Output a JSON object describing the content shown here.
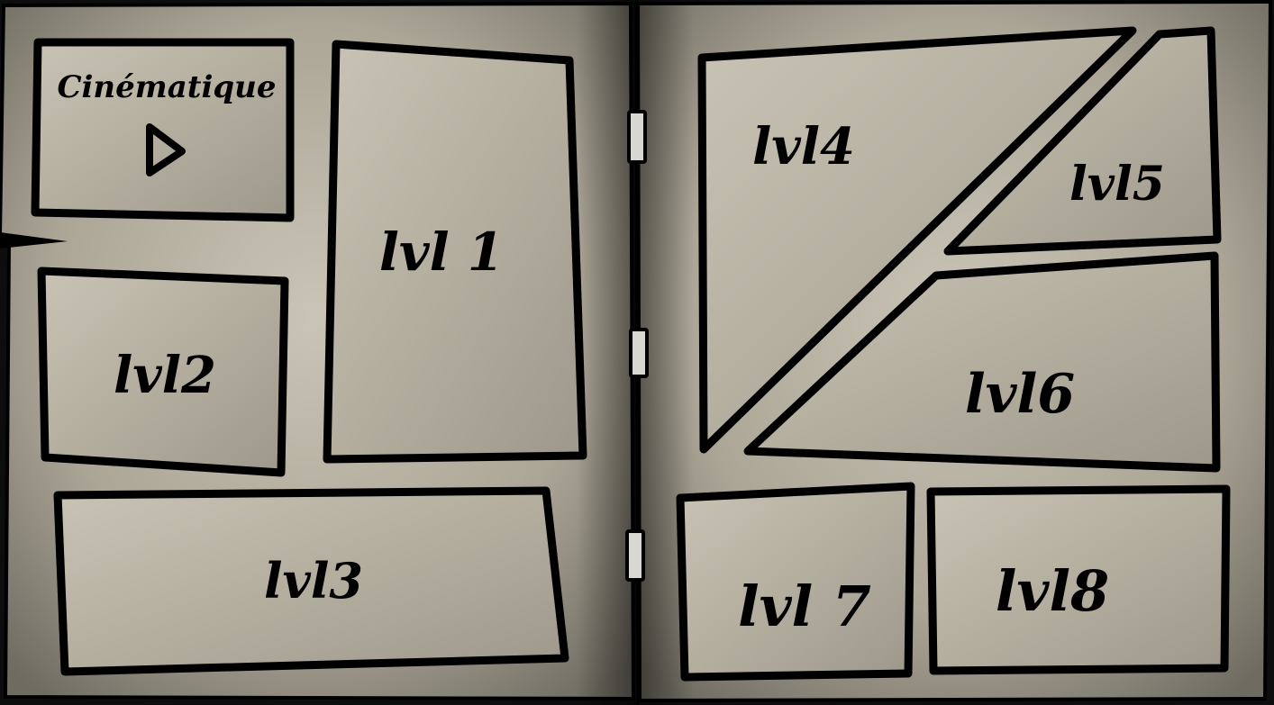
{
  "menu": {
    "cinematic": {
      "label": "Cinématique",
      "icon": "play-icon"
    },
    "levels": [
      {
        "label": "lvl 1"
      },
      {
        "label": "lvl2"
      },
      {
        "label": "lvl3"
      },
      {
        "label": "lvl4"
      },
      {
        "label": "lvl5"
      },
      {
        "label": "lvl6"
      },
      {
        "label": "lvl 7"
      },
      {
        "label": "lvl8"
      }
    ]
  },
  "colors": {
    "paper": "#b8b2a2",
    "paper_dark": "#8f8a7d",
    "ink": "#000000",
    "ring": "#d9d7d2"
  }
}
